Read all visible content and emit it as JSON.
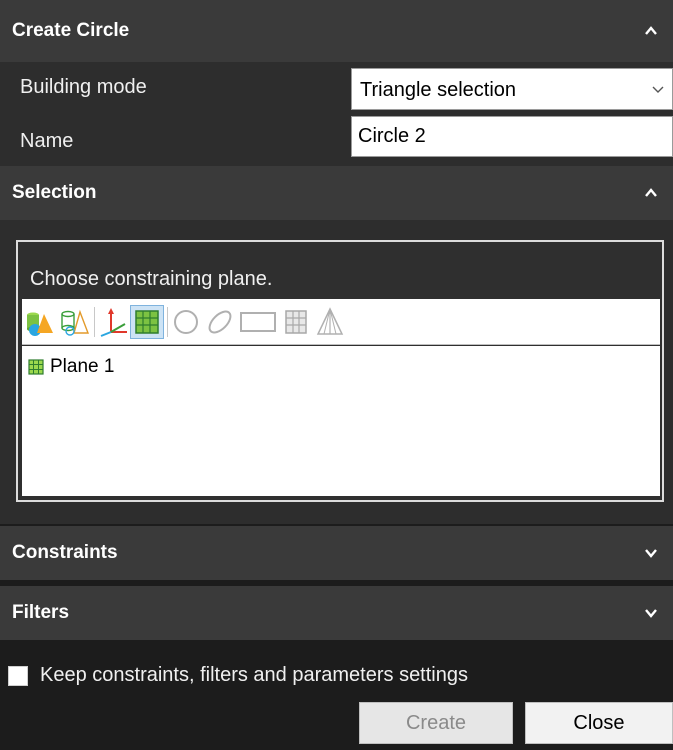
{
  "create_circle": {
    "title": "Create Circle",
    "building_mode_label": "Building mode",
    "building_mode_value": "Triangle selection",
    "name_label": "Name",
    "name_value": "Circle 2"
  },
  "selection": {
    "title": "Selection",
    "prompt": "Choose constraining plane.",
    "toolbar_icons": [
      "solids-icon",
      "cylinder-cone-icon",
      "axes-icon",
      "plane-icon",
      "circle-icon",
      "ellipse-icon",
      "rectangle-icon",
      "grid-icon",
      "pyramid-icon"
    ],
    "items": [
      {
        "label": "Plane 1",
        "icon": "plane-icon"
      }
    ]
  },
  "constraints": {
    "title": "Constraints"
  },
  "filters": {
    "title": "Filters"
  },
  "keep_settings_label": "Keep constraints, filters and parameters settings",
  "buttons": {
    "create": "Create",
    "close": "Close"
  },
  "colors": {
    "header_bg": "#3a3a3a",
    "panel_bg": "#2d2d2d",
    "app_bg": "#1c1c1c",
    "plane_green": "#2ea44f"
  }
}
